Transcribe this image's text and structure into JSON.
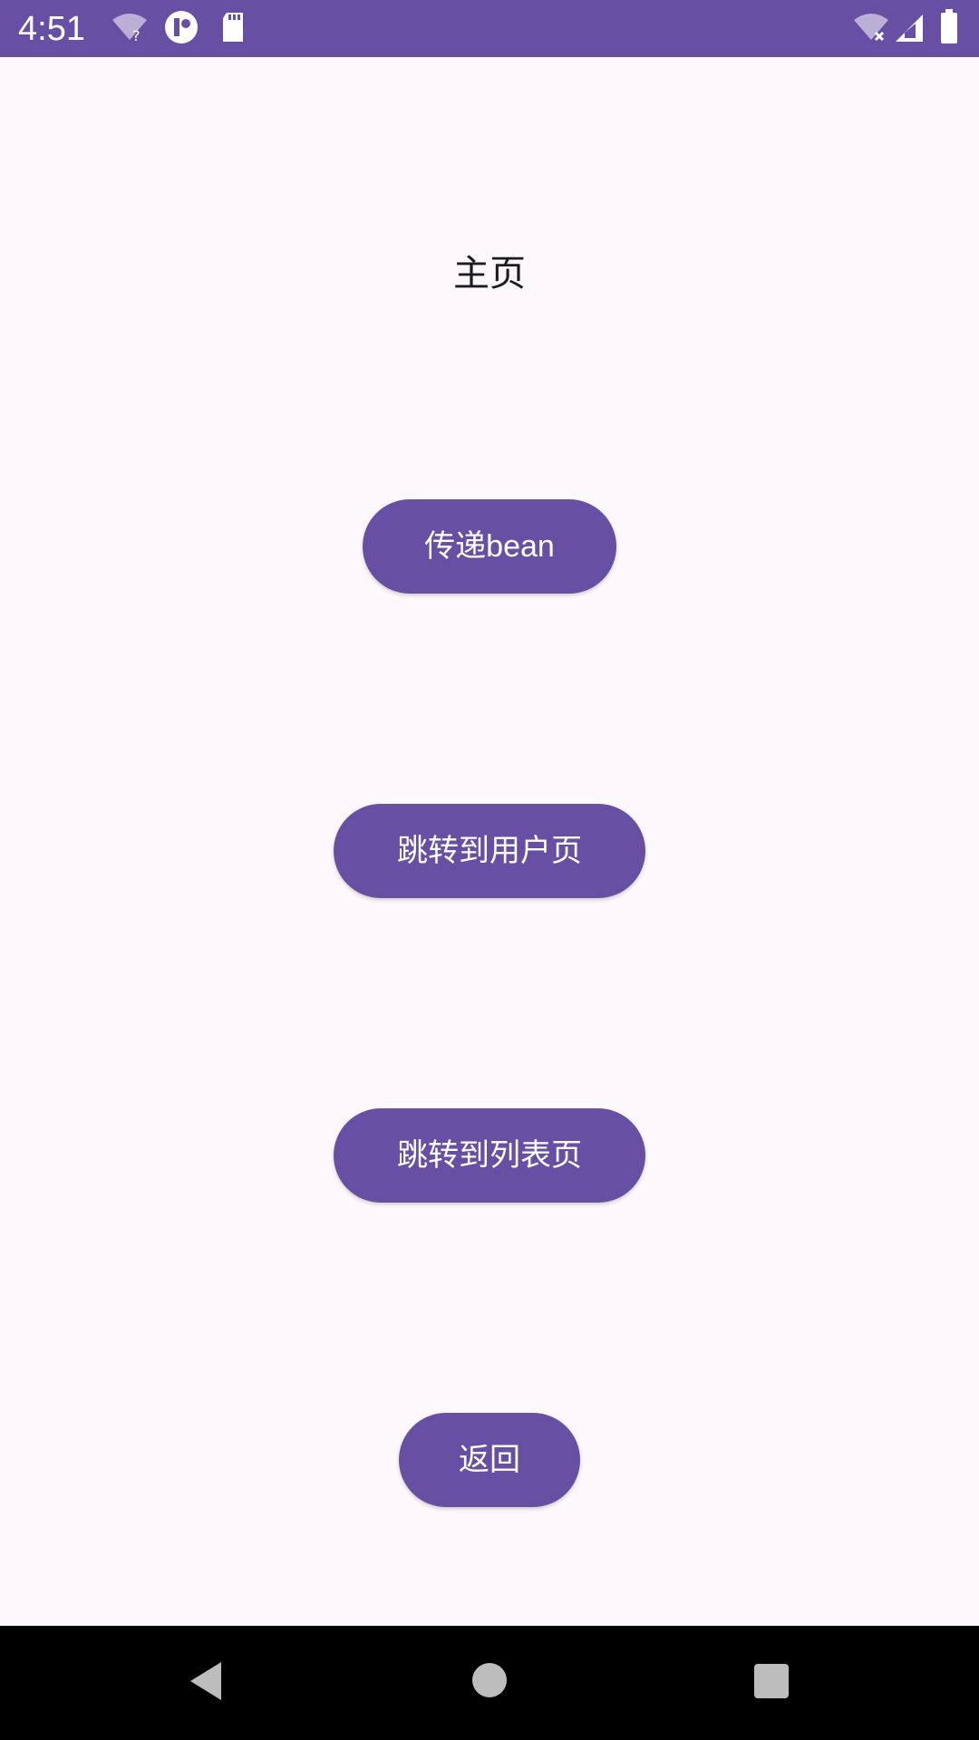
{
  "status_bar": {
    "time": "4:51",
    "background_color": "#6750a4",
    "icons_left": [
      "wifi-question-icon",
      "notification-icon",
      "sd-card-icon"
    ],
    "icons_right": [
      "wifi-x-icon",
      "signal-icon",
      "battery-icon"
    ]
  },
  "page": {
    "title": "主页"
  },
  "buttons": {
    "pass_bean": "传递bean",
    "goto_user_page": "跳转到用户页",
    "goto_list_page": "跳转到列表页",
    "back": "返回"
  },
  "colors": {
    "accent": "#6750a4",
    "background": "#fcf8fc",
    "button_text": "#ffffff"
  },
  "nav_bar": {
    "icons": [
      "back-icon",
      "home-icon",
      "recents-icon"
    ]
  }
}
